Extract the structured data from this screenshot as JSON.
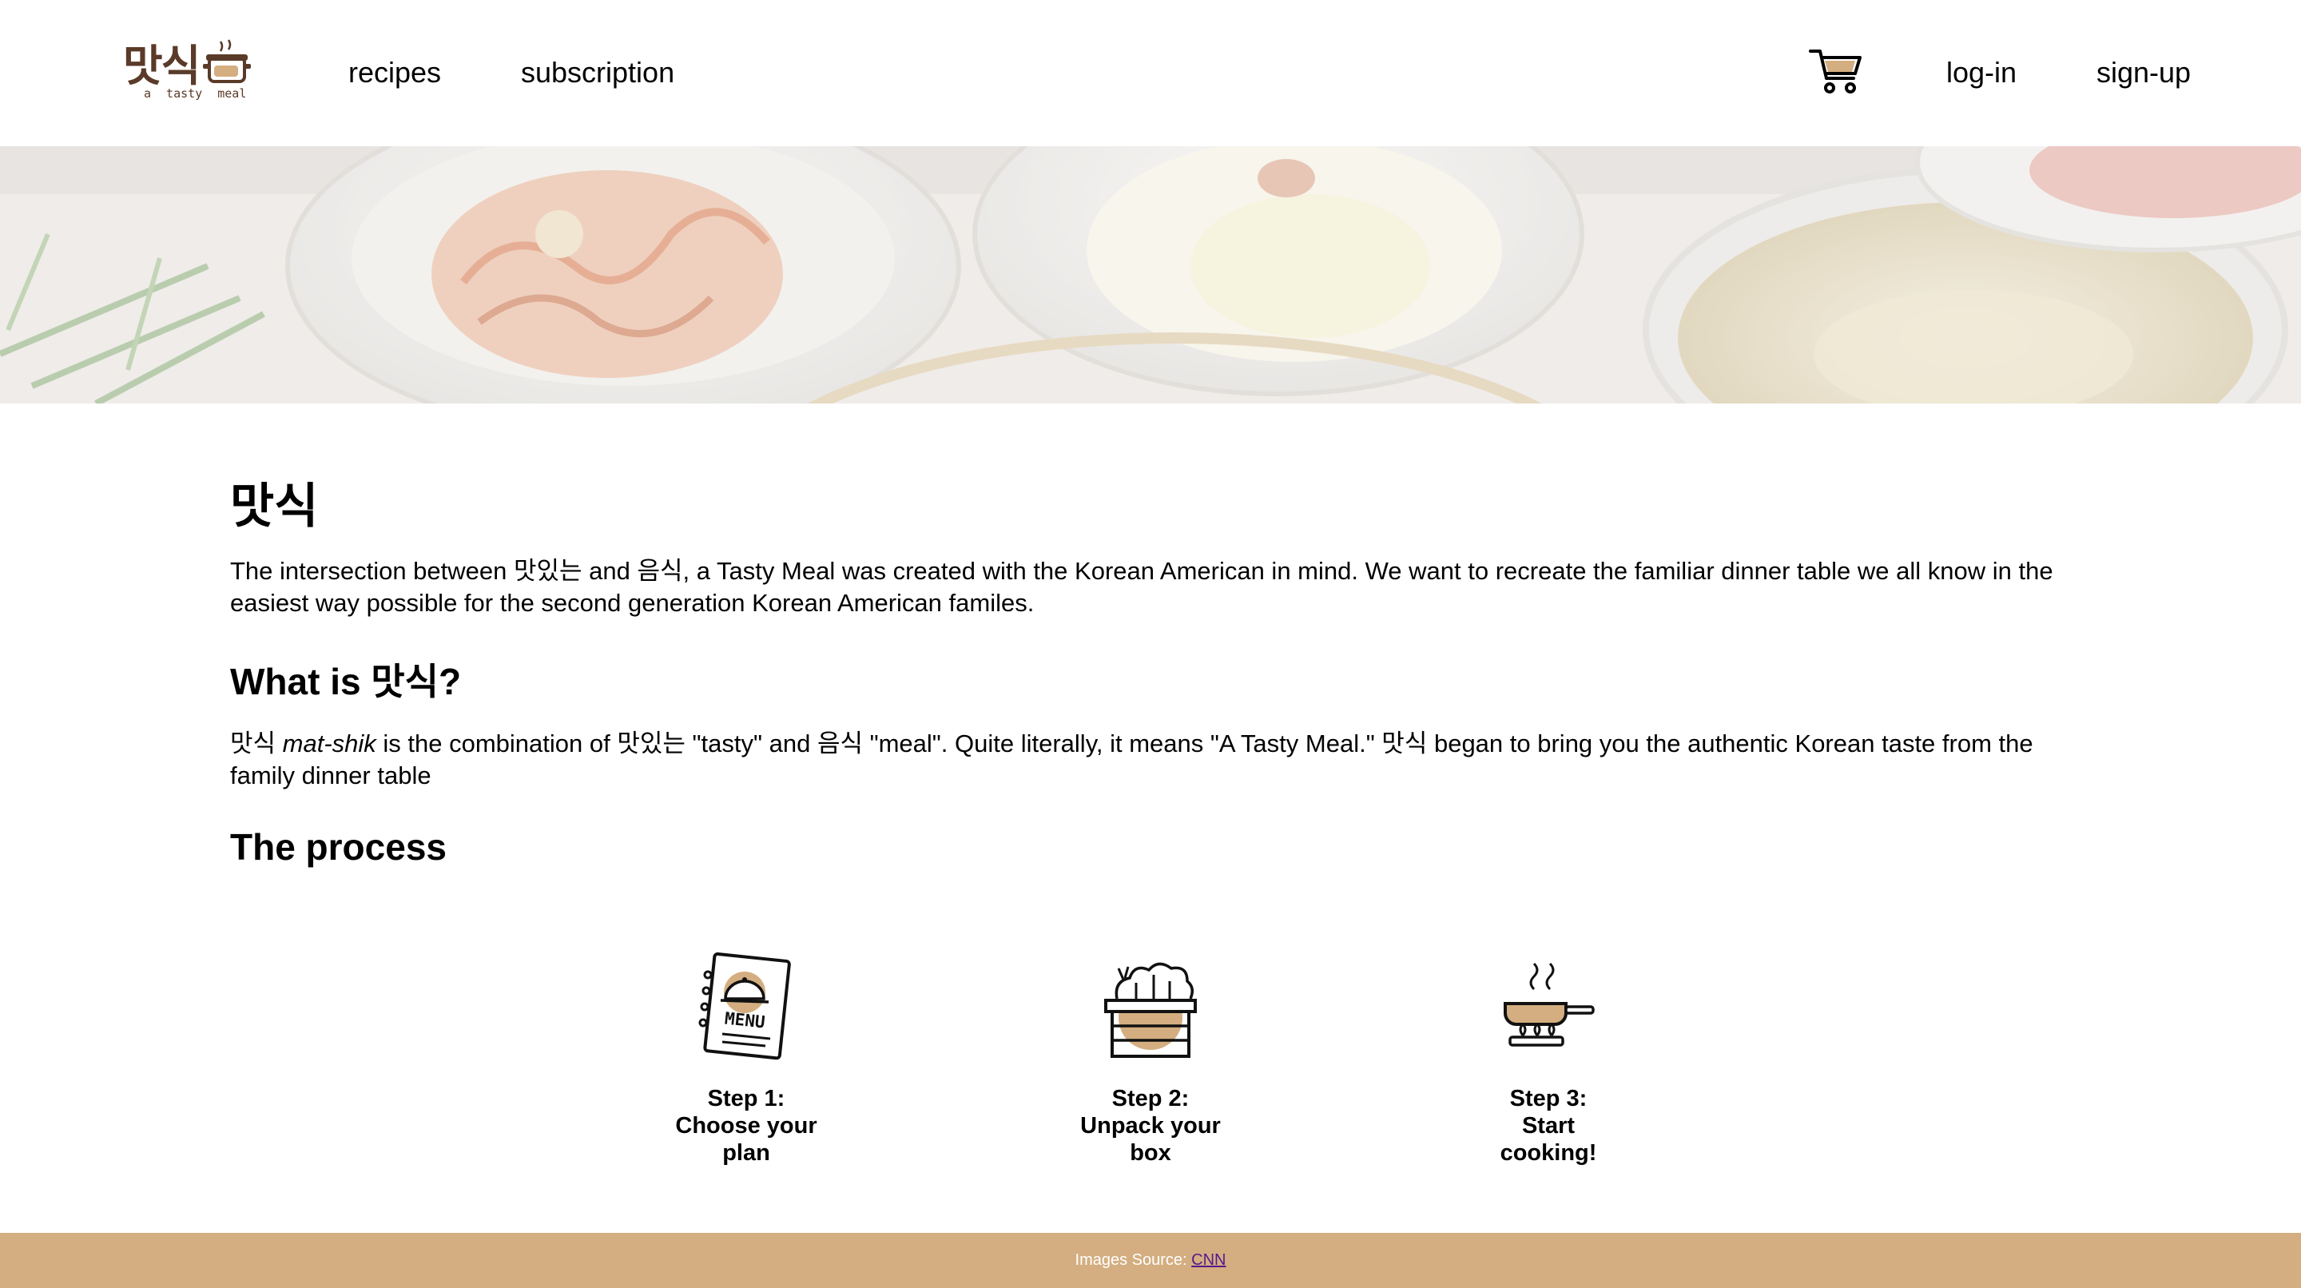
{
  "header": {
    "logo_text": "맛식",
    "logo_subtitle": "a tasty meal",
    "nav": {
      "recipes": "recipes",
      "subscription": "subscription"
    },
    "auth": {
      "login": "log-in",
      "signup": "sign-up"
    }
  },
  "main": {
    "title": "맛식",
    "intro": "The intersection between 맛있는 and 음식, a Tasty Meal was created with the Korean American in mind. We want to recreate the familiar dinner table we all know in the easiest way possible for the second generation Korean American familes.",
    "what_heading": "What is 맛식?",
    "what_text": {
      "lead": "맛식 ",
      "italic": "mat-shik",
      "rest": " is the combination of 맛있는 \"tasty\" and 음식 \"meal\". Quite literally, it means \"A Tasty Meal.\" 맛식 began to bring you the authentic Korean taste from the family dinner table"
    },
    "process_heading": "The process",
    "steps": [
      {
        "line1": "Step 1:",
        "line2": "Choose your",
        "line3": "plan",
        "icon": "menu-icon"
      },
      {
        "line1": "Step 2:",
        "line2": "Unpack your",
        "line3": "box",
        "icon": "vegetable-box-icon"
      },
      {
        "line1": "Step 3:",
        "line2": "Start",
        "line3": "cooking!",
        "icon": "frying-pan-icon"
      }
    ]
  },
  "footer": {
    "source_label": "Images Source: ",
    "source_link": "CNN"
  },
  "colors": {
    "accent": "#d4ae80",
    "logo": "#5a3a28"
  }
}
